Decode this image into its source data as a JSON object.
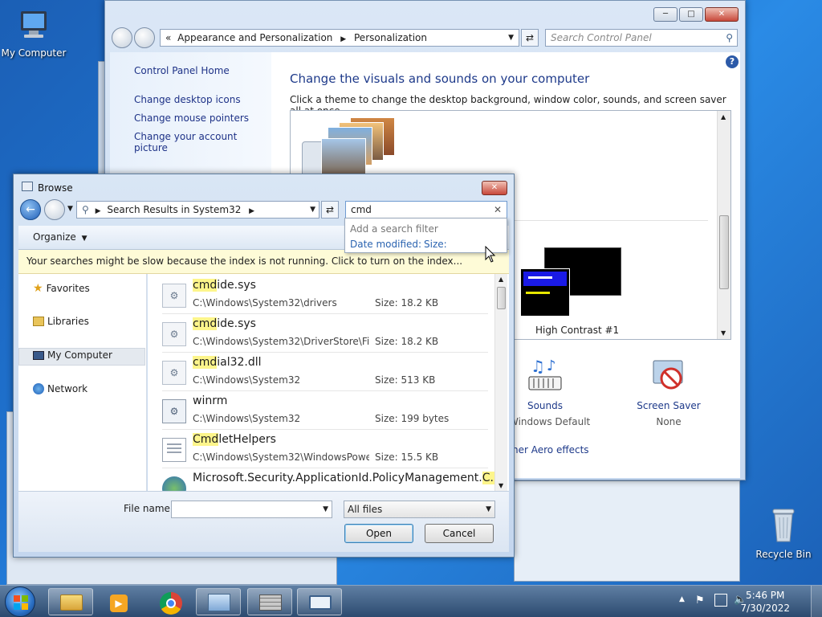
{
  "desktop": {
    "my_computer": "My Computer",
    "recycle_bin": "Recycle Bin"
  },
  "control_panel": {
    "breadcrumb_root": "Appearance and Personalization",
    "breadcrumb_current": "Personalization",
    "search_placeholder": "Search Control Panel",
    "nav": [
      "Control Panel Home",
      "Change desktop icons",
      "Change mouse pointers",
      "Change your account picture"
    ],
    "title": "Change the visuals and sounds on your computer",
    "subtitle": "Click a theme to change the desktop background, window color, sounds, and screen saver all at once.",
    "theme_high_contrast": "High Contrast #1",
    "sounds_label": "Sounds",
    "sounds_value": "Windows Default",
    "screensaver_label": "Screen Saver",
    "screensaver_value": "None",
    "aero_link": "her Aero effects"
  },
  "browse": {
    "title": "Browse",
    "location": "Search Results in System32",
    "search_value": "cmd",
    "filter_hint": "Add a search filter",
    "filter_date": "Date modified:",
    "filter_size": "Size:",
    "organize": "Organize",
    "info_bar": "Your searches might be slow because the index is not running.  Click to turn on the index...",
    "nav": [
      "Favorites",
      "Libraries",
      "My Computer",
      "Network"
    ],
    "files": [
      {
        "hl": "cmd",
        "rest": "ide.sys",
        "path": "C:\\Windows\\System32\\drivers",
        "size": "Size: 18.2 KB"
      },
      {
        "hl": "cmd",
        "rest": "ide.sys",
        "path": "C:\\Windows\\System32\\DriverStore\\Fil...",
        "size": "Size: 18.2 KB"
      },
      {
        "hl": "cmd",
        "rest": "ial32.dll",
        "path": "C:\\Windows\\System32",
        "size": "Size: 513 KB"
      },
      {
        "hl": "",
        "rest": "winrm",
        "path": "C:\\Windows\\System32",
        "size": "Size: 199 bytes"
      },
      {
        "hl": "Cmd",
        "rest": "letHelpers",
        "path": "C:\\Windows\\System32\\WindowsPowe...",
        "size": "Size: 15.5 KB"
      },
      {
        "hl": "",
        "rest": "Microsoft.Security.ApplicationId.PolicyManagement.",
        "hl2": "C...",
        "path": "",
        "size": ""
      }
    ],
    "file_name_label": "File name:",
    "file_name_value": "",
    "file_type": "All files",
    "open": "Open",
    "cancel": "Cancel"
  },
  "taskbar": {
    "time": "5:46 PM",
    "date": "7/30/2022"
  }
}
